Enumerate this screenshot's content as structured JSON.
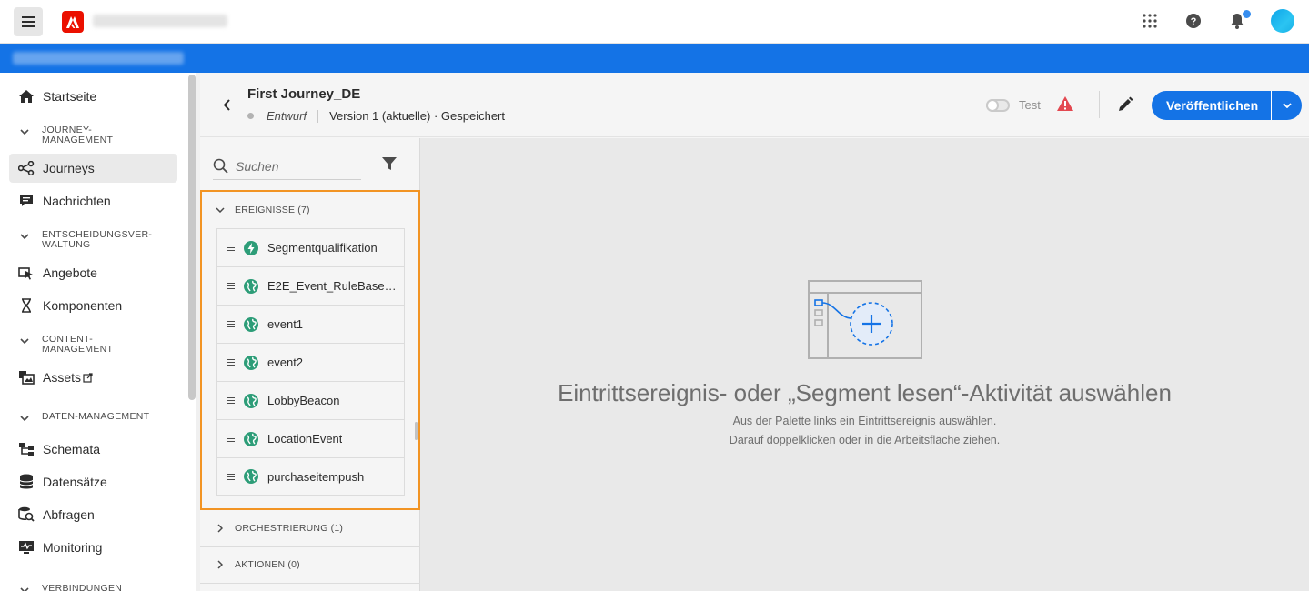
{
  "topbar": {
    "menu_icon": "hamburger-icon",
    "logo": "adobe-logo",
    "icons": [
      "apps-grid-icon",
      "help-icon",
      "bell-icon",
      "avatar"
    ],
    "accent": "#1473e6"
  },
  "sidebar": {
    "items": [
      {
        "type": "item",
        "label": "Startseite",
        "icon": "home-icon"
      },
      {
        "type": "heading",
        "label": "JOURNEY-\nMANAGEMENT"
      },
      {
        "type": "item",
        "label": "Journeys",
        "icon": "journey-icon",
        "active": true
      },
      {
        "type": "item",
        "label": "Nachrichten",
        "icon": "message-icon"
      },
      {
        "type": "heading",
        "label": "ENTSCHEIDUNGSVER-\nWALTUNG"
      },
      {
        "type": "item",
        "label": "Angebote",
        "icon": "offers-icon"
      },
      {
        "type": "item",
        "label": "Komponenten",
        "icon": "components-icon"
      },
      {
        "type": "heading",
        "label": "CONTENT-\nMANAGEMENT"
      },
      {
        "type": "item",
        "label": "Assets",
        "icon": "assets-icon",
        "external": true
      },
      {
        "type": "heading",
        "label": "DATEN-MANAGEMENT"
      },
      {
        "type": "item",
        "label": "Schemata",
        "icon": "schema-icon"
      },
      {
        "type": "item",
        "label": "Datensätze",
        "icon": "datasets-icon"
      },
      {
        "type": "item",
        "label": "Abfragen",
        "icon": "queries-icon"
      },
      {
        "type": "item",
        "label": "Monitoring",
        "icon": "monitoring-icon"
      },
      {
        "type": "heading",
        "label": "VERBINDUNGEN"
      }
    ]
  },
  "journey": {
    "title": "First Journey_DE",
    "status": "Entwurf",
    "version": "Version 1 (aktuelle) · Gespeichert",
    "test_label": "Test",
    "publish_label": "Veröffentlichen"
  },
  "palette": {
    "search_placeholder": "Suchen",
    "events_heading": "EREIGNISSE (7)",
    "events": [
      {
        "label": "Segmentqualifikation",
        "icon": "lightning-icon"
      },
      {
        "label": "E2E_Event_RuleBased...",
        "icon": "globe-icon"
      },
      {
        "label": "event1",
        "icon": "globe-icon"
      },
      {
        "label": "event2",
        "icon": "globe-icon"
      },
      {
        "label": "LobbyBeacon",
        "icon": "globe-icon"
      },
      {
        "label": "LocationEvent",
        "icon": "globe-icon"
      },
      {
        "label": "purchaseitempush",
        "icon": "globe-icon"
      }
    ],
    "orchestration_heading": "ORCHESTRIERUNG (1)",
    "actions_heading": "AKTIONEN (0)"
  },
  "canvas": {
    "title": "Eintrittsereignis- oder „Segment lesen“-Aktivität auswählen",
    "line1": "Aus der Palette links ein Eintrittsereignis auswählen.",
    "line2": "Darauf doppelklicken oder in die Arbeitsfläche ziehen."
  }
}
